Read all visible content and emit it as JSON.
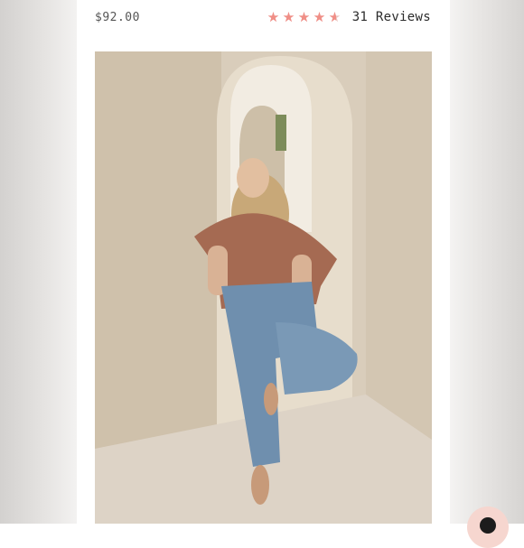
{
  "product": {
    "price": "$92.00",
    "rating": 4.5,
    "reviews_label": "31 Reviews"
  },
  "colors": {
    "star_filled": "#f08e86",
    "star_empty": "#ebc4bf",
    "chat_bubble": "#f6d6cf"
  },
  "icons": {
    "star": "star-icon",
    "chat": "chat-bubble-icon"
  }
}
